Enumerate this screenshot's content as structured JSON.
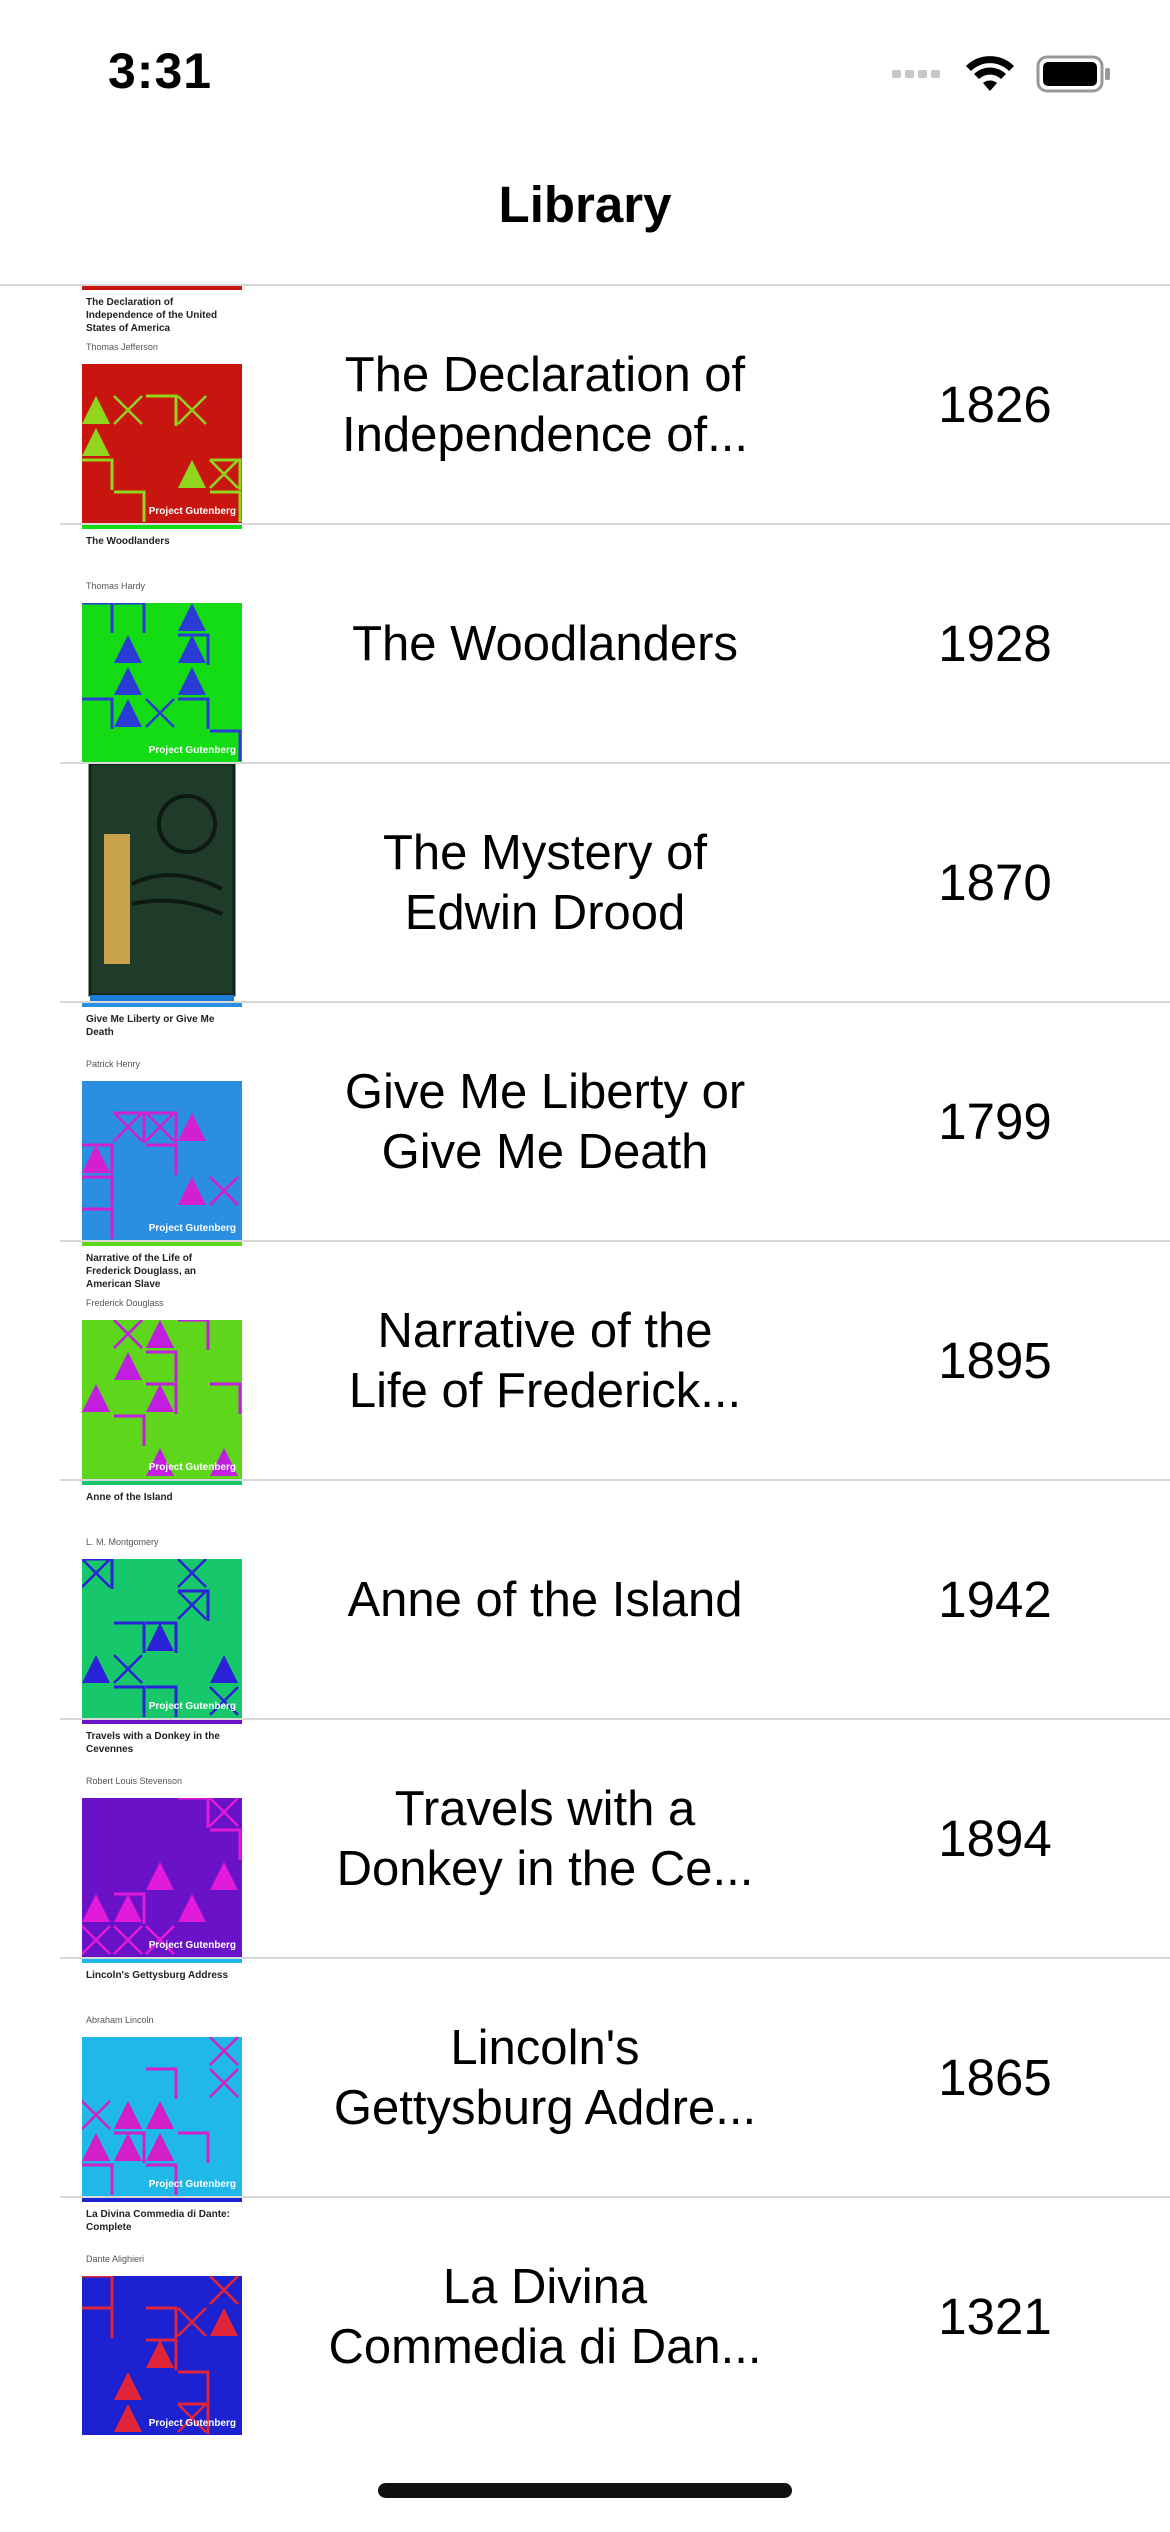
{
  "status": {
    "time": "3:31"
  },
  "nav": {
    "title": "Library"
  },
  "books": [
    {
      "title_lines": [
        "The Declaration of",
        "Independence of..."
      ],
      "year": "1826",
      "cover": {
        "style": "gutenberg",
        "title": "The Declaration of Independence of the United States of America",
        "author": "Thomas Jefferson",
        "bg": "#c8150f",
        "fg": "#8fd61c",
        "bar": "#c8150f",
        "publisher": "Project Gutenberg"
      }
    },
    {
      "title_lines": [
        "The Woodlanders"
      ],
      "year": "1928",
      "cover": {
        "style": "gutenberg",
        "title": "The Woodlanders",
        "author": "Thomas Hardy",
        "bg": "#14dc14",
        "fg": "#2a3bd6",
        "bar": "#14dc14",
        "publisher": "Project Gutenberg"
      }
    },
    {
      "title_lines": [
        "The Mystery of",
        "Edwin Drood"
      ],
      "year": "1870",
      "cover": {
        "style": "photo",
        "bg": "#1f3b2a",
        "fg": "#c8a24a",
        "bar": "#1a7fd4"
      }
    },
    {
      "title_lines": [
        "Give Me Liberty or",
        "Give Me Death"
      ],
      "year": "1799",
      "cover": {
        "style": "gutenberg",
        "title": "Give Me Liberty or Give Me Death",
        "author": "Patrick Henry",
        "bg": "#2a8fe0",
        "fg": "#d41fd0",
        "bar": "#2a8fe0",
        "publisher": "Project Gutenberg"
      }
    },
    {
      "title_lines": [
        "Narrative of the",
        "Life of Frederick..."
      ],
      "year": "1895",
      "cover": {
        "style": "gutenberg",
        "title": "Narrative of the Life of Frederick Douglass, an American Slave",
        "author": "Frederick Douglass",
        "bg": "#5ed61c",
        "fg": "#c21ee0",
        "bar": "#5ed61c",
        "publisher": "Project Gutenberg"
      }
    },
    {
      "title_lines": [
        "Anne of the Island"
      ],
      "year": "1942",
      "cover": {
        "style": "gutenberg",
        "title": "Anne of the Island",
        "author": "L. M. Montgomery",
        "bg": "#17c86b",
        "fg": "#2a22d8",
        "bar": "#17c86b",
        "publisher": "Project Gutenberg"
      }
    },
    {
      "title_lines": [
        "Travels with a",
        "Donkey in the Ce..."
      ],
      "year": "1894",
      "cover": {
        "style": "gutenberg",
        "title": "Travels with a Donkey in the Cevennes",
        "author": "Robert Louis Stevenson",
        "bg": "#6a12c8",
        "fg": "#e01ad8",
        "bar": "#6a12c8",
        "publisher": "Project Gutenberg"
      }
    },
    {
      "title_lines": [
        "Lincoln's",
        "Gettysburg Addre..."
      ],
      "year": "1865",
      "cover": {
        "style": "gutenberg",
        "title": "Lincoln's Gettysburg Address",
        "author": "Abraham Lincoln",
        "bg": "#1fb8e8",
        "fg": "#d41fc8",
        "bar": "#1fb8e8",
        "publisher": "Project Gutenberg"
      }
    },
    {
      "title_lines": [
        "La Divina",
        "Commedia di Dan..."
      ],
      "year": "1321",
      "cover": {
        "style": "gutenberg",
        "title": "La Divina Commedia di Dante: Complete",
        "author": "Dante Alighieri",
        "bg": "#1c22d0",
        "fg": "#e0243a",
        "bar": "#1c22d0",
        "publisher": "Project Gutenberg"
      }
    }
  ]
}
